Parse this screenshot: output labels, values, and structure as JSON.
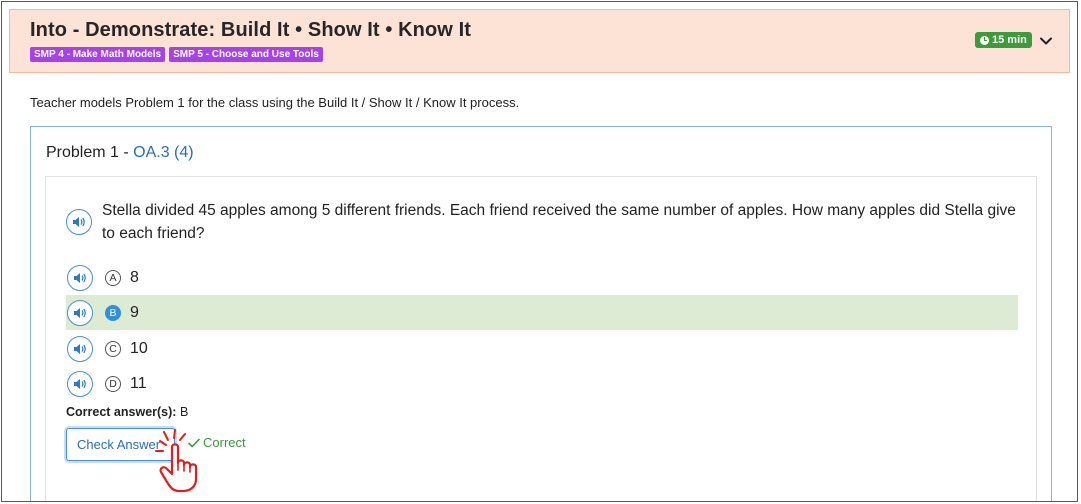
{
  "header": {
    "title": "Into - Demonstrate: Build It • Show It • Know It",
    "tags": [
      "SMP 4 - Make Math Models",
      "SMP 5 - Choose and Use Tools"
    ],
    "time_badge": "15 min",
    "icons": {
      "time": "clock-icon",
      "toggle": "chevron-down-icon"
    }
  },
  "intro_text": "Teacher models Problem 1 for the class using the Build It / Show It / Know It process.",
  "problem": {
    "title_prefix": "Problem 1 - ",
    "standard": "OA.3 (4)",
    "question": "Stella divided 45 apples among 5 different friends. Each friend received the same number of apples. How many apples did Stella give to each friend?",
    "choices": [
      {
        "letter": "A",
        "value": "8",
        "selected": false
      },
      {
        "letter": "B",
        "value": "9",
        "selected": true
      },
      {
        "letter": "C",
        "value": "10",
        "selected": false
      },
      {
        "letter": "D",
        "value": "11",
        "selected": false
      }
    ],
    "correct_answers_label": "Correct answer(s):",
    "correct_answers_value": "B",
    "check_button_label": "Check Answer",
    "feedback": "Correct"
  },
  "colors": {
    "header_bg": "#fde3d6",
    "tag_purple": "#a542e8",
    "badge_green": "#3d9b39",
    "link_blue": "#2a6db5",
    "selected_row": "#deebd4",
    "correct_green": "#3a9a3a",
    "cursor_red": "#e01e1e"
  }
}
